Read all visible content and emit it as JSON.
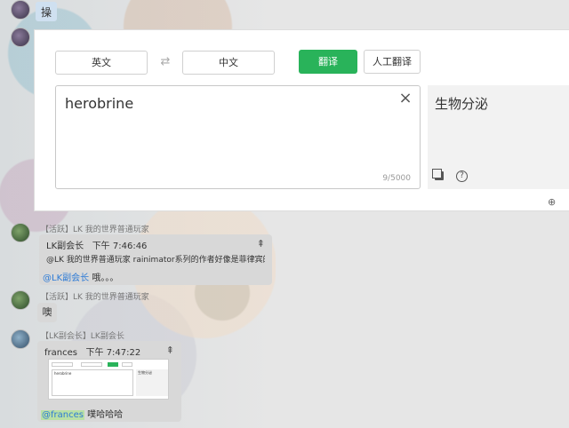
{
  "top_message": {
    "text": "操"
  },
  "translator": {
    "source_lang": "英文",
    "target_lang": "中文",
    "translate_label": "翻译",
    "human_translate_label": "人工翻译",
    "source_text": "herobrine",
    "char_count": "9/5000",
    "result_text": "生物分泌"
  },
  "chat": {
    "msg1": {
      "meta": "【活跃】LK 我的世界普通玩家",
      "quote_author": "LK副会长",
      "quote_time": "下午 7:46:46",
      "quote_body": "@LK 我的世界普通玩家 rainimator系列的作者好像是菲律宾的",
      "mention": "@LK副会长",
      "text": " 哦。。。"
    },
    "msg2": {
      "meta": "【活跃】LK 我的世界普通玩家",
      "text": "噢"
    },
    "msg3": {
      "meta": "【LK副会长】LK副会长",
      "quote_author": "frances",
      "quote_time": "下午 7:47:22",
      "thumb_source": "herobrine",
      "thumb_result": "生物分泌",
      "mention": "@frances",
      "text": " 噗哈哈哈"
    }
  },
  "colors": {
    "accent": "#29b35a",
    "mention": "#2e7bd6"
  }
}
